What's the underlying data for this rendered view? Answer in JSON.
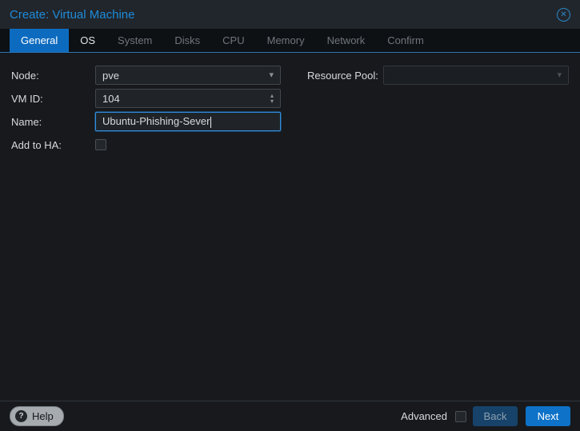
{
  "window": {
    "title": "Create: Virtual Machine"
  },
  "icons": {
    "close": "✕",
    "chevron_down": "▾",
    "spinner_up": "▴",
    "spinner_down": "▾",
    "help": "?"
  },
  "tabs": [
    {
      "label": "General",
      "state": "active"
    },
    {
      "label": "OS",
      "state": "enabled"
    },
    {
      "label": "System",
      "state": "disabled"
    },
    {
      "label": "Disks",
      "state": "disabled"
    },
    {
      "label": "CPU",
      "state": "disabled"
    },
    {
      "label": "Memory",
      "state": "disabled"
    },
    {
      "label": "Network",
      "state": "disabled"
    },
    {
      "label": "Confirm",
      "state": "disabled"
    }
  ],
  "form": {
    "node_label": "Node:",
    "node_value": "pve",
    "vmid_label": "VM ID:",
    "vmid_value": "104",
    "name_label": "Name:",
    "name_value": "Ubuntu-Phishing-Sever",
    "ha_label": "Add to HA:",
    "ha_checked": false,
    "resource_pool_label": "Resource Pool:",
    "resource_pool_value": ""
  },
  "footer": {
    "help": "Help",
    "advanced": "Advanced",
    "advanced_checked": false,
    "back": "Back",
    "next": "Next"
  },
  "colors": {
    "accent_blue": "#1e8bd8",
    "active_tab_bg": "#0d6bbf",
    "focus_border": "#2f8fe2",
    "next_button_bg": "#0e72c8",
    "dialog_bg": "#17191d",
    "titlebar_bg": "#21262c"
  }
}
